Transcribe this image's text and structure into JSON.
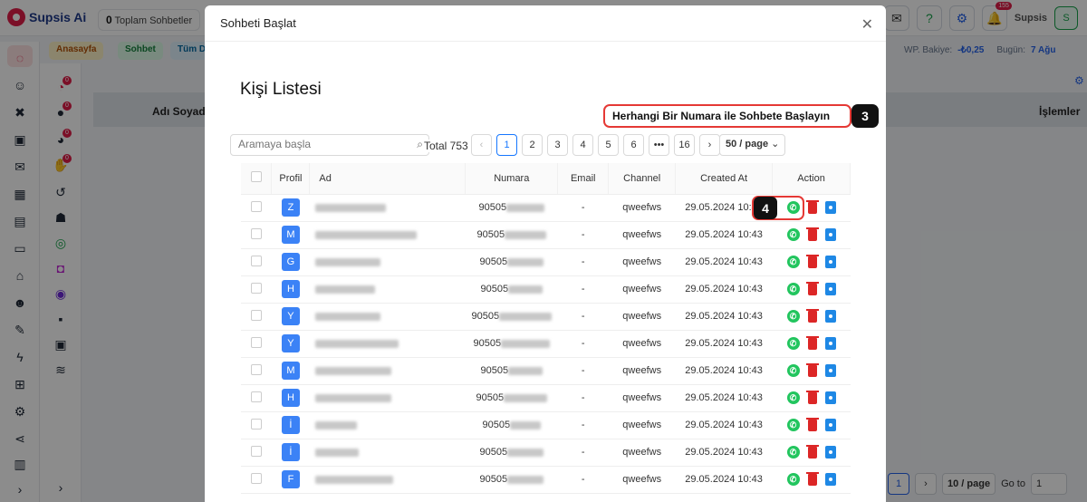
{
  "app": {
    "logo": "Supsis Ai",
    "stat_value": "0",
    "stat_label": "Toplam Sohbetler",
    "user": "Supsis",
    "user_initial": "S",
    "notif_count": "155"
  },
  "nav": {
    "home": "Anasayfa",
    "chat": "Sohbet",
    "all": "Tüm De",
    "wp_label": "WP. Bakiye:",
    "wp_value": "-₺0,25",
    "today_label": "Bugün:",
    "today_value": "7 Ağu"
  },
  "bg_table": {
    "col_name": "Adı Soyadı",
    "col_actions": "İşlemler"
  },
  "bg_pagination": {
    "page": "1",
    "page_size": "10 / page",
    "goto_label": "Go to",
    "goto_value": "1"
  },
  "modal": {
    "header": "Sohbeti Başlat",
    "title": "Kişi Listesi",
    "start_any_number": "Herhangi Bir Numara ile Sohbete Başlayın",
    "step3": "3",
    "step4": "4",
    "search_placeholder": "Aramaya başla",
    "total": "Total 753",
    "pages": [
      "1",
      "2",
      "3",
      "4",
      "5",
      "6",
      "•••",
      "16"
    ],
    "page_size": "50 / page",
    "columns": {
      "profile": "Profil",
      "name": "Ad",
      "number": "Numara",
      "email": "Email",
      "channel": "Channel",
      "created": "Created At",
      "action": "Action"
    },
    "rows": [
      {
        "initial": "Z",
        "number_prefix": "90505",
        "email": "-",
        "channel": "qweefws",
        "created": "29.05.2024 10:43"
      },
      {
        "initial": "M",
        "number_prefix": "90505",
        "email": "-",
        "channel": "qweefws",
        "created": "29.05.2024 10:43"
      },
      {
        "initial": "G",
        "number_prefix": "90505",
        "email": "-",
        "channel": "qweefws",
        "created": "29.05.2024 10:43"
      },
      {
        "initial": "H",
        "number_prefix": "90505",
        "email": "-",
        "channel": "qweefws",
        "created": "29.05.2024 10:43"
      },
      {
        "initial": "Y",
        "number_prefix": "90505",
        "email": "-",
        "channel": "qweefws",
        "created": "29.05.2024 10:43"
      },
      {
        "initial": "Y",
        "number_prefix": "90505",
        "email": "-",
        "channel": "qweefws",
        "created": "29.05.2024 10:43"
      },
      {
        "initial": "M",
        "number_prefix": "90505",
        "email": "-",
        "channel": "qweefws",
        "created": "29.05.2024 10:43"
      },
      {
        "initial": "H",
        "number_prefix": "90505",
        "email": "-",
        "channel": "qweefws",
        "created": "29.05.2024 10:43"
      },
      {
        "initial": "İ",
        "number_prefix": "90505",
        "email": "-",
        "channel": "qweefws",
        "created": "29.05.2024 10:43"
      },
      {
        "initial": "İ",
        "number_prefix": "90505",
        "email": "-",
        "channel": "qweefws",
        "created": "29.05.2024 10:43"
      },
      {
        "initial": "F",
        "number_prefix": "90505",
        "email": "-",
        "channel": "qweefws",
        "created": "29.05.2024 10:43"
      }
    ]
  }
}
